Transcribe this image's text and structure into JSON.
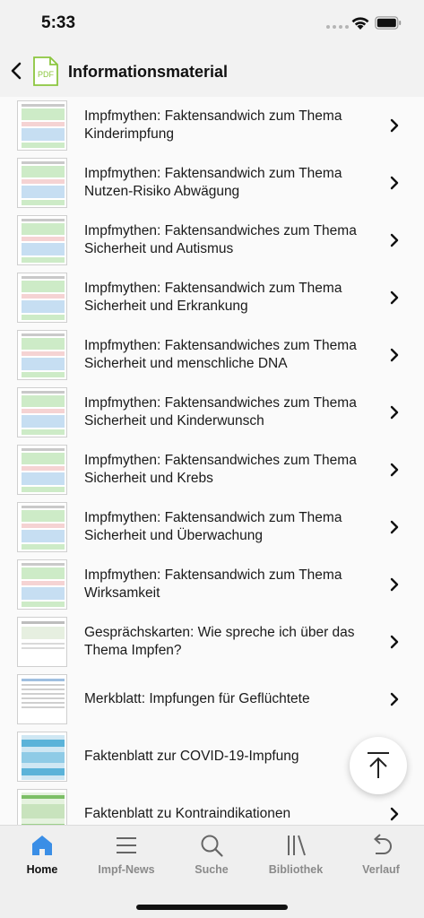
{
  "status": {
    "time": "5:33"
  },
  "nav": {
    "title": "Informationsmaterial",
    "pdf_label": "PDF"
  },
  "items": [
    {
      "label": "Impfmythen: Faktensandwich zum Thema Kinderimpfung",
      "thumb": "mythen"
    },
    {
      "label": "Impfmythen: Faktensandwich zum Thema Nutzen-Risiko Abwägung",
      "thumb": "mythen"
    },
    {
      "label": "Impfmythen: Faktensandwiches zum Thema Sicherheit und Autismus",
      "thumb": "mythen"
    },
    {
      "label": "Impfmythen: Faktensandwich zum Thema Sicherheit und Erkrankung",
      "thumb": "mythen"
    },
    {
      "label": "Impfmythen: Faktensandwiches zum Thema Sicherheit und menschliche DNA",
      "thumb": "mythen"
    },
    {
      "label": "Impfmythen: Faktensandwiches zum Thema Sicherheit und Kinderwunsch",
      "thumb": "mythen"
    },
    {
      "label": "Impfmythen: Faktensandwiches zum Thema Sicherheit und Krebs",
      "thumb": "mythen"
    },
    {
      "label": "Impfmythen: Faktensandwich zum Thema Sicherheit und Überwachung",
      "thumb": "mythen"
    },
    {
      "label": "Impfmythen: Faktensandwich zum Thema Wirksamkeit",
      "thumb": "mythen"
    },
    {
      "label": "Gesprächskarten: Wie spreche ich über das Thema Impfen?",
      "thumb": "karten"
    },
    {
      "label": "Merkblatt: Impfungen für Geflüchtete",
      "thumb": "merkblatt"
    },
    {
      "label": "Faktenblatt zur COVID-19-Impfung",
      "thumb": "covid"
    },
    {
      "label": "Faktenblatt zu Kontraindikationen",
      "thumb": "kontra"
    }
  ],
  "tabs": [
    {
      "label": "Home",
      "icon": "home-icon",
      "active": true
    },
    {
      "label": "Impf-News",
      "icon": "menu-icon",
      "active": false
    },
    {
      "label": "Suche",
      "icon": "search-icon",
      "active": false
    },
    {
      "label": "Bibliothek",
      "icon": "library-icon",
      "active": false
    },
    {
      "label": "Verlauf",
      "icon": "history-icon",
      "active": false
    }
  ],
  "colors": {
    "accent": "#3a8ee6",
    "pdf_green": "#8cc63f",
    "thumb_green": "#cdebc7",
    "thumb_blue": "#c6def2",
    "thumb_pink": "#f5d3d3"
  }
}
